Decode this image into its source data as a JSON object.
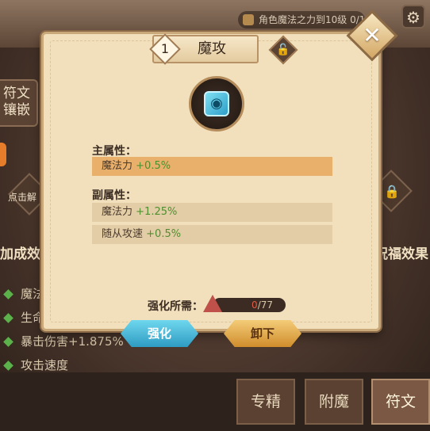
{
  "background": {
    "quest_text": "角色魔法之力到10级 0/1",
    "left_tab_label": "符文镶嵌",
    "unlock_hint": "点击解",
    "left_header": "加成效果",
    "right_header": "祝福效果",
    "effects": [
      "魔法",
      "生命",
      "暴击伤害+1.875%",
      "攻击速度"
    ],
    "bottom_tabs": [
      "专精",
      "附魔",
      "符文"
    ],
    "active_tab": "符文"
  },
  "modal": {
    "level": "1",
    "title": "魔攻",
    "close_symbol": "✕",
    "lock_symbol": "🔓",
    "primary_label": "主属性：",
    "primary_stats": [
      {
        "name": "魔法力",
        "value": "+0.5%"
      }
    ],
    "sub_label": "副属性：",
    "sub_stats": [
      {
        "name": "魔法力",
        "value": "+1.25%"
      },
      {
        "name": "随从攻速",
        "value": "+0.5%"
      }
    ],
    "cost_label": "强化所需：",
    "cost_current": "0",
    "cost_total": "/77",
    "enhance_button": "强化",
    "unequip_button": "卸下"
  },
  "colors": {
    "accent_blue": "#2e9bc2",
    "accent_gold": "#d08d2c",
    "stat_green": "#4f8f2f"
  }
}
